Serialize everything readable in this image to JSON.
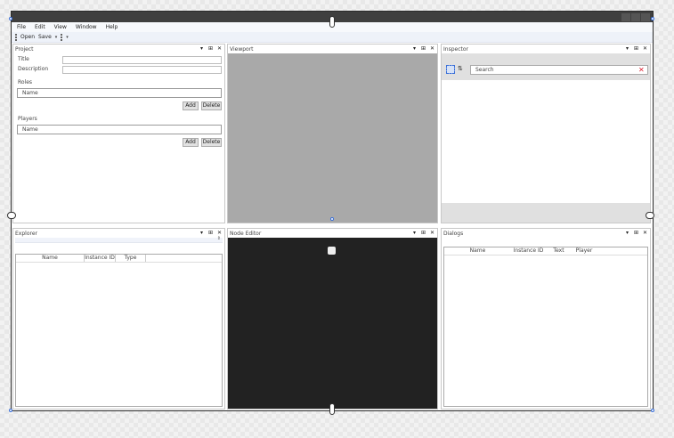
{
  "menu": [
    "File",
    "Edit",
    "View",
    "Window",
    "Help"
  ],
  "toolbar": {
    "open": "Open",
    "save": "Save"
  },
  "panel_controls": {
    "menu": "▾",
    "pin": "⊞",
    "close": "✕"
  },
  "project": {
    "title": "Project",
    "title_label": "Title",
    "description_label": "Description",
    "roles_label": "Roles",
    "roles_placeholder": "Name",
    "players_label": "Players",
    "players_placeholder": "Name",
    "add": "Add",
    "delete": "Delete"
  },
  "viewport": {
    "title": "Viewport"
  },
  "inspector": {
    "title": "Inspector",
    "search_placeholder": "Search",
    "clear_icon": "✕"
  },
  "explorer": {
    "title": "Explorer",
    "columns": [
      "Name",
      "Instance ID",
      "Type"
    ]
  },
  "node_editor": {
    "title": "Node Editor"
  },
  "dialogs": {
    "title": "Dialogs",
    "columns": [
      "Name",
      "Instance ID",
      "Text",
      "Player"
    ]
  },
  "colors": {
    "viewport_bg": "#a9a9a9",
    "node_editor_bg": "#222222",
    "titlebar": "#3f3f3f",
    "selection": "#3a6fd8"
  }
}
